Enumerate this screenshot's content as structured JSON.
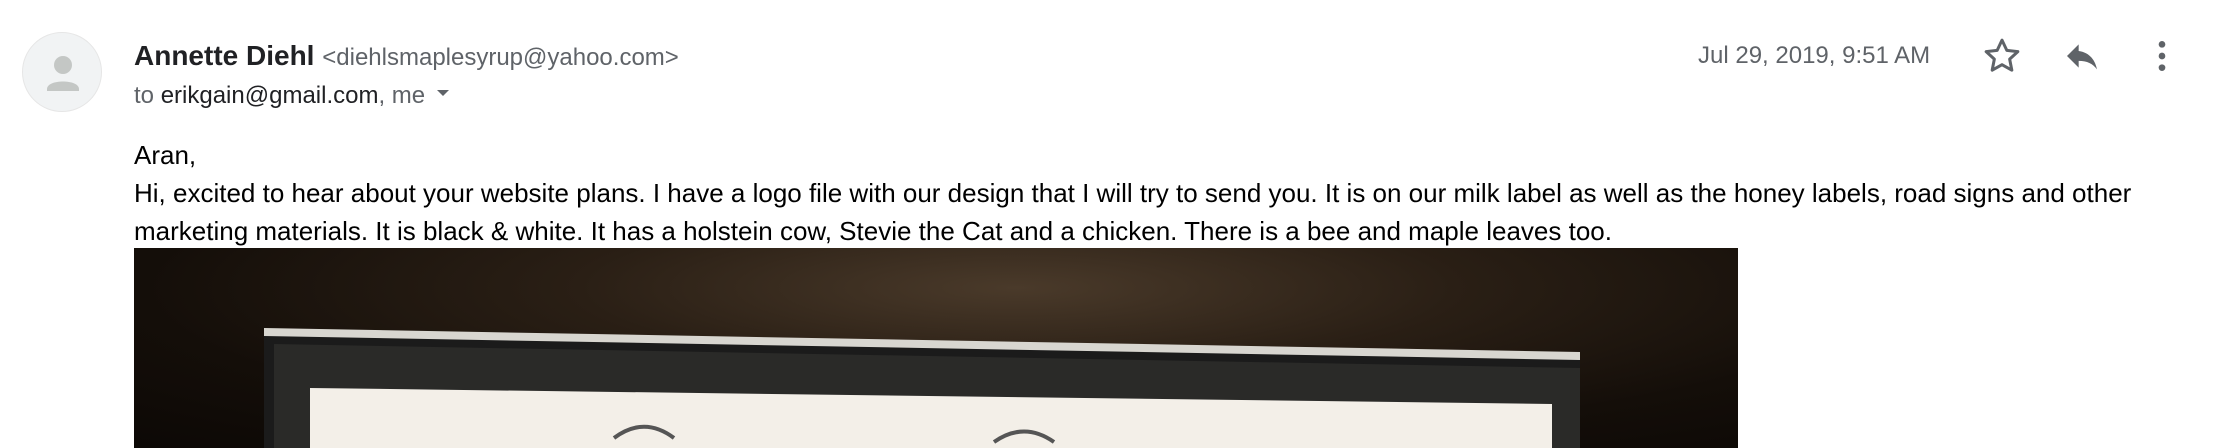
{
  "sender": {
    "name": "Annette Diehl",
    "email": "<diehlsmaplesyrup@yahoo.com>"
  },
  "recipients": {
    "prefix": "to",
    "primary": "erikgain@gmail.com",
    "others": ", me"
  },
  "date": "Jul 29, 2019, 9:51 AM",
  "actions": {
    "star_icon": "star-outline-icon",
    "reply_icon": "reply-icon",
    "more_icon": "more-vert-icon"
  },
  "body": {
    "greeting": "Aran,",
    "paragraph": "Hi, excited to hear about your website plans. I have a logo file with our design that I will try to send you.  It is on our milk label as well as the honey labels, road signs and other marketing materials. It is black & white. It has a holstein cow, Stevie the Cat and a chicken. There is a bee and maple leaves too."
  },
  "colors": {
    "name_text": "#202124",
    "secondary_text": "#5f6368",
    "icon": "#5f6368",
    "body_text": "#000000"
  }
}
